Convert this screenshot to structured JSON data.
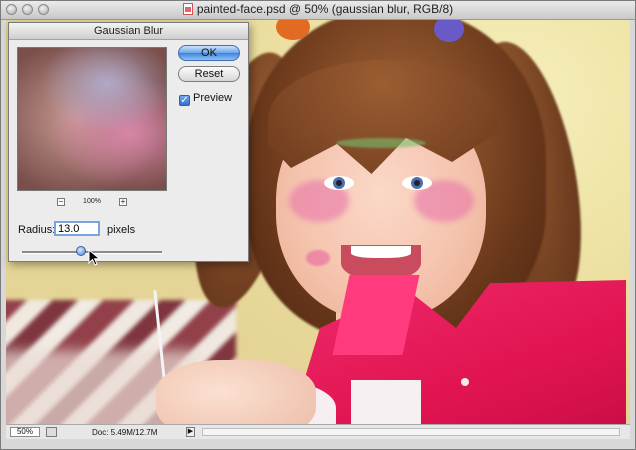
{
  "window": {
    "title": "painted-face.psd @ 50% (gaussian blur, RGB/8)",
    "traffic_lights": [
      "close-button",
      "minimize-button",
      "zoom-button"
    ]
  },
  "dialog": {
    "title": "Gaussian Blur",
    "ok_label": "OK",
    "reset_label": "Reset",
    "preview_label": "Preview",
    "preview_checked": true,
    "preview_zoom": "100%",
    "zoom_out_label": "−",
    "zoom_in_label": "+",
    "radius_label": "Radius:",
    "radius_value": "13.0",
    "radius_unit": "pixels",
    "accent_color": "#3e83d9"
  },
  "statusbar": {
    "zoom": "50%",
    "doc_info": "Doc: 5.49M/12.7M",
    "arrow_glyph": "▶"
  },
  "colors": {
    "shirt": "#e11451",
    "wall": "#efe4a2",
    "hair": "#6d3a1c"
  }
}
